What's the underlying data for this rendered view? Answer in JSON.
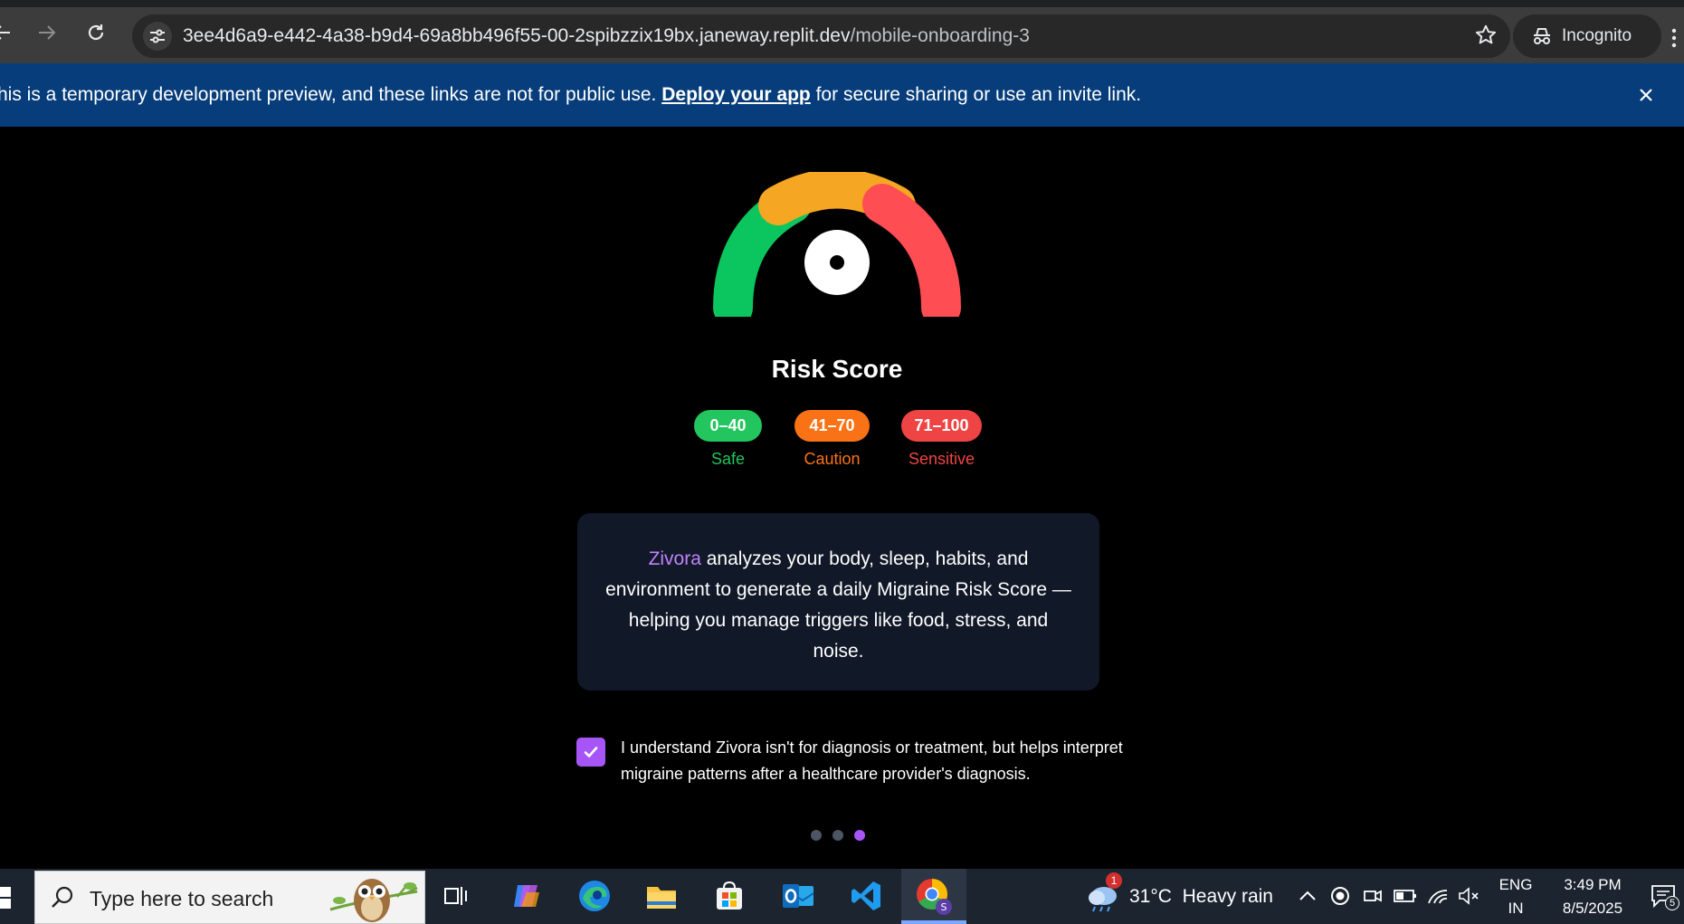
{
  "browser": {
    "url_host": "3ee4d6a9-e442-4a38-b9d4-69a8bb496f55-00-2spibzzix19bx.janeway.replit.dev",
    "url_path": "/mobile-onboarding-3",
    "profile_label": "Incognito"
  },
  "banner": {
    "text_before": "his is a temporary development preview, and these links are not for public use. ",
    "link_text": "Deploy your app",
    "text_after": " for secure sharing or use an invite link."
  },
  "page": {
    "title": "Risk Score",
    "ranges": [
      {
        "range": "0–40",
        "label": "Safe",
        "color": "#22c55e"
      },
      {
        "range": "41–70",
        "label": "Caution",
        "color": "#f97316"
      },
      {
        "range": "71–100",
        "label": "Sensitive",
        "color": "#ef4444"
      }
    ],
    "gauge_colors": {
      "green": "#0bc65f",
      "amber": "#f5a623",
      "red": "#ff4d54"
    },
    "description_brand": "Zivora",
    "description_rest": " analyzes your body, sleep, habits, and environment to generate a daily Migraine Risk Score — helping you manage triggers like food, stress, and noise.",
    "consent_checked": true,
    "consent_text": "I understand Zivora isn't for diagnosis or treatment, but helps interpret migraine patterns after a healthcare provider's diagnosis.",
    "pagination": {
      "total": 3,
      "active": 3
    }
  },
  "taskbar": {
    "search_placeholder": "Type here to search",
    "weather_temp": "31°C",
    "weather_desc": "Heavy rain",
    "weather_badge": "1",
    "lang_top": "ENG",
    "lang_bottom": "IN",
    "time": "3:49 PM",
    "date": "8/5/2025",
    "notification_count": "5",
    "pinned_apps": [
      "task-view",
      "copilot",
      "edge",
      "file-explorer",
      "microsoft-store",
      "outlook",
      "vs-code",
      "chrome"
    ]
  },
  "accent": {
    "purple": "#a855f7",
    "banner_blue": "#063d7a",
    "card_bg": "#111827"
  }
}
